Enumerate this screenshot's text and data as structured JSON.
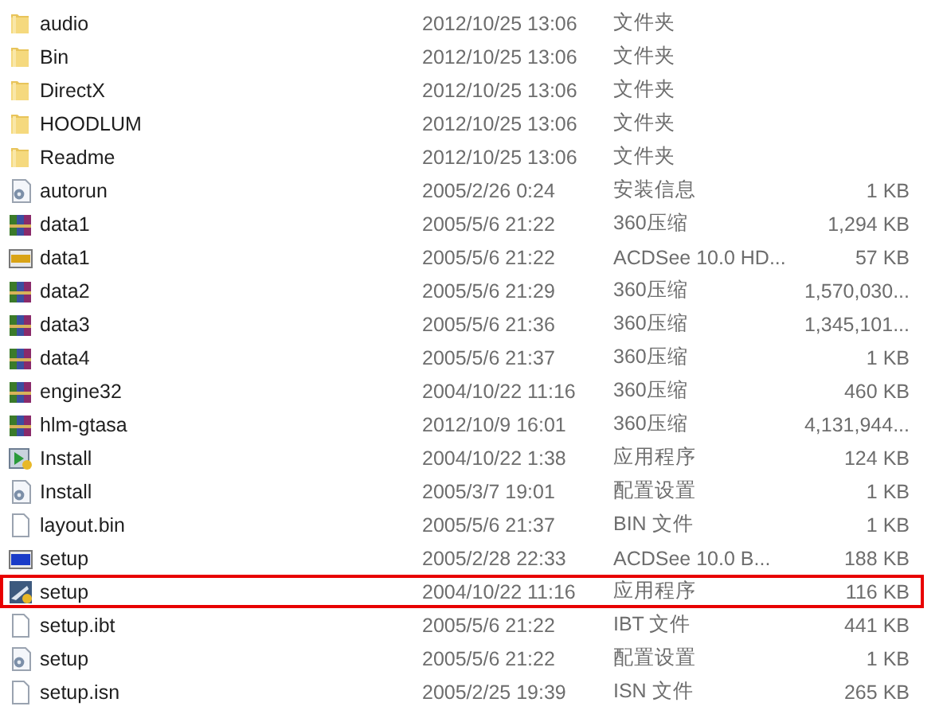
{
  "files": [
    {
      "kind": "folder",
      "name": "audio",
      "date": "2012/10/25 13:06",
      "type": "文件夹",
      "highlighted": false
    },
    {
      "kind": "folder",
      "name": "Bin",
      "date": "2012/10/25 13:06",
      "type": "文件夹",
      "highlighted": false
    },
    {
      "kind": "folder",
      "name": "DirectX",
      "date": "2012/10/25 13:06",
      "type": "文件夹",
      "highlighted": false
    },
    {
      "kind": "folder",
      "name": "HOODLUM",
      "date": "2012/10/25 13:06",
      "type": "文件夹",
      "highlighted": false
    },
    {
      "kind": "folder",
      "name": "Readme",
      "date": "2012/10/25 13:06",
      "type": "文件夹",
      "highlighted": false
    },
    {
      "kind": "settings",
      "name": "autorun",
      "date": "2005/2/26 0:24",
      "type": "安装信息",
      "size": "1 KB",
      "highlighted": false
    },
    {
      "kind": "archive",
      "name": "data1",
      "date": "2005/5/6 21:22",
      "type": "360压缩",
      "size": "1,294 KB",
      "highlighted": false
    },
    {
      "kind": "raw",
      "name": "data1",
      "date": "2005/5/6 21:22",
      "type": "ACDSee 10.0 HD...",
      "size": "57 KB",
      "highlighted": false
    },
    {
      "kind": "archive",
      "name": "data2",
      "date": "2005/5/6 21:29",
      "type": "360压缩",
      "size": "1,570,030...",
      "highlighted": false
    },
    {
      "kind": "archive",
      "name": "data3",
      "date": "2005/5/6 21:36",
      "type": "360压缩",
      "size": "1,345,101...",
      "highlighted": false
    },
    {
      "kind": "archive",
      "name": "data4",
      "date": "2005/5/6 21:37",
      "type": "360压缩",
      "size": "1 KB",
      "highlighted": false
    },
    {
      "kind": "archive",
      "name": "engine32",
      "date": "2004/10/22 11:16",
      "type": "360压缩",
      "size": "460 KB",
      "highlighted": false
    },
    {
      "kind": "archive",
      "name": "hlm-gtasa",
      "date": "2012/10/9 16:01",
      "type": "360压缩",
      "size": "4,131,944...",
      "highlighted": false
    },
    {
      "kind": "installer",
      "name": "Install",
      "date": "2004/10/22 1:38",
      "type": "应用程序",
      "size": "124 KB",
      "highlighted": false
    },
    {
      "kind": "settings",
      "name": "Install",
      "date": "2005/3/7 19:01",
      "type": "配置设置",
      "size": "1 KB",
      "highlighted": false
    },
    {
      "kind": "blank",
      "name": "layout.bin",
      "date": "2005/5/6 21:37",
      "type": "BIN 文件",
      "size": "1 KB",
      "highlighted": false
    },
    {
      "kind": "bmp",
      "name": "setup",
      "date": "2005/2/28 22:33",
      "type": "ACDSee 10.0 B...",
      "size": "188 KB",
      "highlighted": false
    },
    {
      "kind": "app",
      "name": "setup",
      "date": "2004/10/22 11:16",
      "type": "应用程序",
      "size": "116 KB",
      "highlighted": true
    },
    {
      "kind": "blank",
      "name": "setup.ibt",
      "date": "2005/5/6 21:22",
      "type": "IBT 文件",
      "size": "441 KB",
      "highlighted": false
    },
    {
      "kind": "settings",
      "name": "setup",
      "date": "2005/5/6 21:22",
      "type": "配置设置",
      "size": "1 KB",
      "highlighted": false
    },
    {
      "kind": "blank",
      "name": "setup.isn",
      "date": "2005/2/25 19:39",
      "type": "ISN 文件",
      "size": "265 KB",
      "highlighted": false
    }
  ]
}
